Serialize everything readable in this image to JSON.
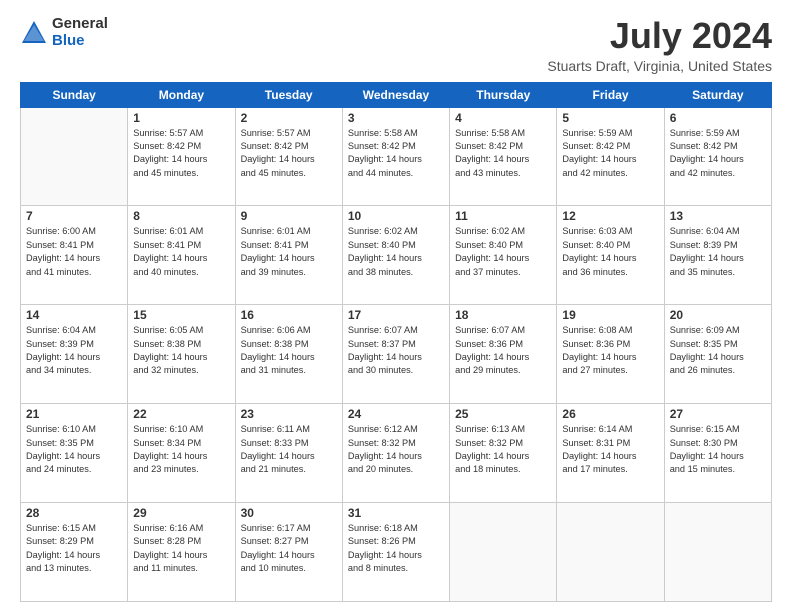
{
  "header": {
    "logo_general": "General",
    "logo_blue": "Blue",
    "month_title": "July 2024",
    "location": "Stuarts Draft, Virginia, United States"
  },
  "days_of_week": [
    "Sunday",
    "Monday",
    "Tuesday",
    "Wednesday",
    "Thursday",
    "Friday",
    "Saturday"
  ],
  "weeks": [
    [
      {
        "day": "",
        "info": ""
      },
      {
        "day": "1",
        "info": "Sunrise: 5:57 AM\nSunset: 8:42 PM\nDaylight: 14 hours\nand 45 minutes."
      },
      {
        "day": "2",
        "info": "Sunrise: 5:57 AM\nSunset: 8:42 PM\nDaylight: 14 hours\nand 45 minutes."
      },
      {
        "day": "3",
        "info": "Sunrise: 5:58 AM\nSunset: 8:42 PM\nDaylight: 14 hours\nand 44 minutes."
      },
      {
        "day": "4",
        "info": "Sunrise: 5:58 AM\nSunset: 8:42 PM\nDaylight: 14 hours\nand 43 minutes."
      },
      {
        "day": "5",
        "info": "Sunrise: 5:59 AM\nSunset: 8:42 PM\nDaylight: 14 hours\nand 42 minutes."
      },
      {
        "day": "6",
        "info": "Sunrise: 5:59 AM\nSunset: 8:42 PM\nDaylight: 14 hours\nand 42 minutes."
      }
    ],
    [
      {
        "day": "7",
        "info": "Sunrise: 6:00 AM\nSunset: 8:41 PM\nDaylight: 14 hours\nand 41 minutes."
      },
      {
        "day": "8",
        "info": "Sunrise: 6:01 AM\nSunset: 8:41 PM\nDaylight: 14 hours\nand 40 minutes."
      },
      {
        "day": "9",
        "info": "Sunrise: 6:01 AM\nSunset: 8:41 PM\nDaylight: 14 hours\nand 39 minutes."
      },
      {
        "day": "10",
        "info": "Sunrise: 6:02 AM\nSunset: 8:40 PM\nDaylight: 14 hours\nand 38 minutes."
      },
      {
        "day": "11",
        "info": "Sunrise: 6:02 AM\nSunset: 8:40 PM\nDaylight: 14 hours\nand 37 minutes."
      },
      {
        "day": "12",
        "info": "Sunrise: 6:03 AM\nSunset: 8:40 PM\nDaylight: 14 hours\nand 36 minutes."
      },
      {
        "day": "13",
        "info": "Sunrise: 6:04 AM\nSunset: 8:39 PM\nDaylight: 14 hours\nand 35 minutes."
      }
    ],
    [
      {
        "day": "14",
        "info": "Sunrise: 6:04 AM\nSunset: 8:39 PM\nDaylight: 14 hours\nand 34 minutes."
      },
      {
        "day": "15",
        "info": "Sunrise: 6:05 AM\nSunset: 8:38 PM\nDaylight: 14 hours\nand 32 minutes."
      },
      {
        "day": "16",
        "info": "Sunrise: 6:06 AM\nSunset: 8:38 PM\nDaylight: 14 hours\nand 31 minutes."
      },
      {
        "day": "17",
        "info": "Sunrise: 6:07 AM\nSunset: 8:37 PM\nDaylight: 14 hours\nand 30 minutes."
      },
      {
        "day": "18",
        "info": "Sunrise: 6:07 AM\nSunset: 8:36 PM\nDaylight: 14 hours\nand 29 minutes."
      },
      {
        "day": "19",
        "info": "Sunrise: 6:08 AM\nSunset: 8:36 PM\nDaylight: 14 hours\nand 27 minutes."
      },
      {
        "day": "20",
        "info": "Sunrise: 6:09 AM\nSunset: 8:35 PM\nDaylight: 14 hours\nand 26 minutes."
      }
    ],
    [
      {
        "day": "21",
        "info": "Sunrise: 6:10 AM\nSunset: 8:35 PM\nDaylight: 14 hours\nand 24 minutes."
      },
      {
        "day": "22",
        "info": "Sunrise: 6:10 AM\nSunset: 8:34 PM\nDaylight: 14 hours\nand 23 minutes."
      },
      {
        "day": "23",
        "info": "Sunrise: 6:11 AM\nSunset: 8:33 PM\nDaylight: 14 hours\nand 21 minutes."
      },
      {
        "day": "24",
        "info": "Sunrise: 6:12 AM\nSunset: 8:32 PM\nDaylight: 14 hours\nand 20 minutes."
      },
      {
        "day": "25",
        "info": "Sunrise: 6:13 AM\nSunset: 8:32 PM\nDaylight: 14 hours\nand 18 minutes."
      },
      {
        "day": "26",
        "info": "Sunrise: 6:14 AM\nSunset: 8:31 PM\nDaylight: 14 hours\nand 17 minutes."
      },
      {
        "day": "27",
        "info": "Sunrise: 6:15 AM\nSunset: 8:30 PM\nDaylight: 14 hours\nand 15 minutes."
      }
    ],
    [
      {
        "day": "28",
        "info": "Sunrise: 6:15 AM\nSunset: 8:29 PM\nDaylight: 14 hours\nand 13 minutes."
      },
      {
        "day": "29",
        "info": "Sunrise: 6:16 AM\nSunset: 8:28 PM\nDaylight: 14 hours\nand 11 minutes."
      },
      {
        "day": "30",
        "info": "Sunrise: 6:17 AM\nSunset: 8:27 PM\nDaylight: 14 hours\nand 10 minutes."
      },
      {
        "day": "31",
        "info": "Sunrise: 6:18 AM\nSunset: 8:26 PM\nDaylight: 14 hours\nand 8 minutes."
      },
      {
        "day": "",
        "info": ""
      },
      {
        "day": "",
        "info": ""
      },
      {
        "day": "",
        "info": ""
      }
    ]
  ]
}
